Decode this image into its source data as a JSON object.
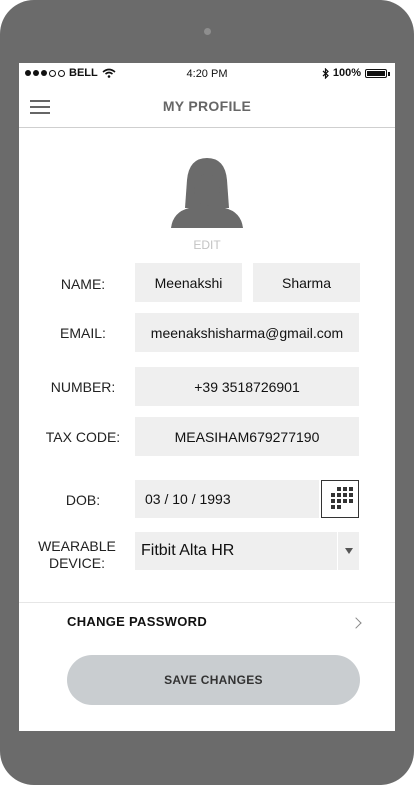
{
  "status_bar": {
    "carrier": "BELL",
    "time": "4:20 PM",
    "battery": "100%"
  },
  "header": {
    "title": "MY PROFILE"
  },
  "avatar": {
    "edit_label": "EDIT"
  },
  "form": {
    "name_label": "NAME:",
    "first_name": "Meenakshi",
    "last_name": "Sharma",
    "email_label": "EMAIL:",
    "email": "meenakshisharma@gmail.com",
    "number_label": "NUMBER:",
    "number": "+39 3518726901",
    "tax_code_label": "TAX CODE:",
    "tax_code": "MEASIHAM679277190",
    "dob_label": "DOB:",
    "dob": "03 / 10 / 1993",
    "wearable_label_line1": "WEARABLE",
    "wearable_label_line2": "DEVICE:",
    "wearable_device": "Fitbit Alta HR"
  },
  "actions": {
    "change_password": "CHANGE PASSWORD",
    "save_changes": "SAVE CHANGES"
  },
  "icons": {
    "menu": "hamburger-icon",
    "avatar": "female-user-icon",
    "calendar": "calendar-grid-icon",
    "dropdown": "caret-down-icon",
    "chevron": "chevron-right-icon",
    "wifi": "wifi-icon",
    "bluetooth": "bluetooth-icon",
    "battery": "battery-icon"
  },
  "colors": {
    "device_frame": "#6b6b6b",
    "field_bg": "#efefef",
    "save_button_bg": "#c9cdd0"
  }
}
